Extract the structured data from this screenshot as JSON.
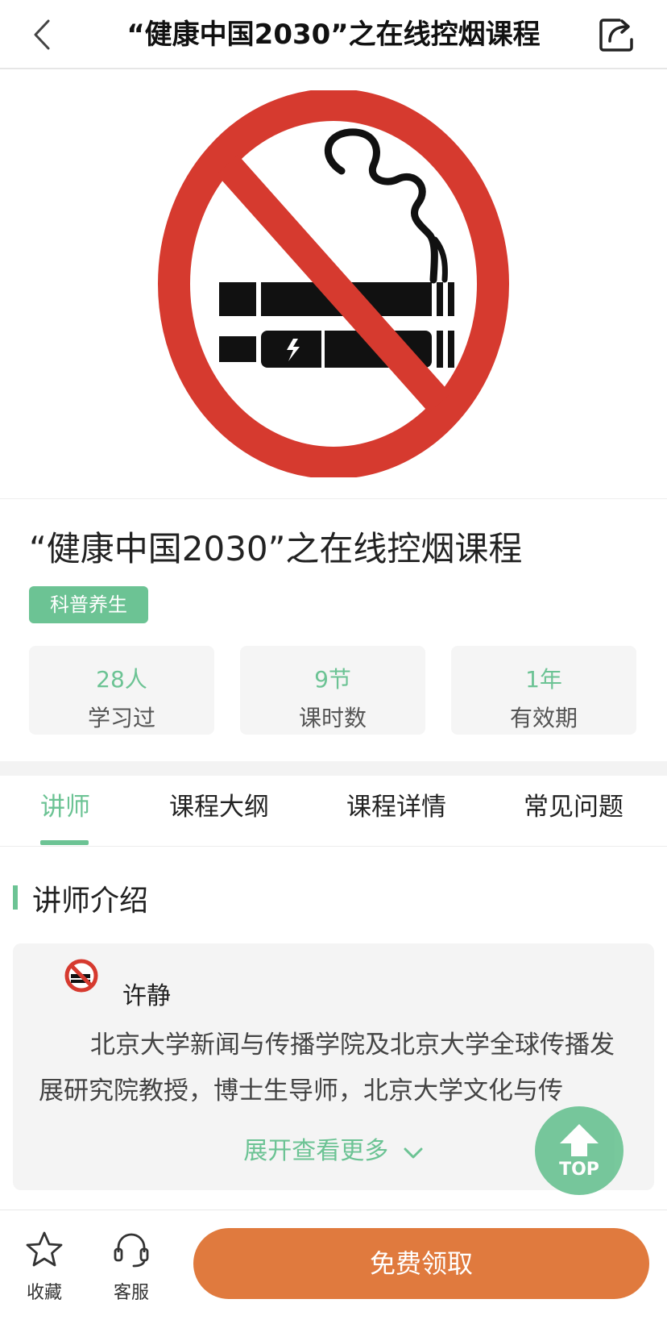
{
  "header": {
    "title": "“健康中国2030”之在线控烟课程"
  },
  "course": {
    "title": "“健康中国2030”之在线控烟课程",
    "tag": "科普养生",
    "stats": [
      {
        "value": "28人",
        "label": "学习过"
      },
      {
        "value": "9节",
        "label": "课时数"
      },
      {
        "value": "1年",
        "label": "有效期"
      }
    ]
  },
  "tabs": [
    {
      "label": "讲师",
      "active": true
    },
    {
      "label": "课程大纲",
      "active": false
    },
    {
      "label": "课程详情",
      "active": false
    },
    {
      "label": "常见问题",
      "active": false
    }
  ],
  "section": {
    "title": "讲师介绍"
  },
  "lecturer": {
    "name": "许静",
    "description": "北京大学新闻与传播学院及北京大学全球传播发展研究院教授，博士生导师，北京大学文化与传",
    "expand_label": "展开查看更多"
  },
  "top_button": {
    "label": "TOP"
  },
  "bottom_bar": {
    "favorite_label": "收藏",
    "service_label": "客服",
    "claim_label": "免费领取"
  },
  "colors": {
    "accent": "#6cc394",
    "cta": "#e07a3e",
    "sign_red": "#d63a2f"
  },
  "icons": [
    "back-chevron-icon",
    "share-icon",
    "no-smoking-icon",
    "star-icon",
    "headset-icon",
    "arrow-up-icon",
    "chevron-down-icon"
  ]
}
